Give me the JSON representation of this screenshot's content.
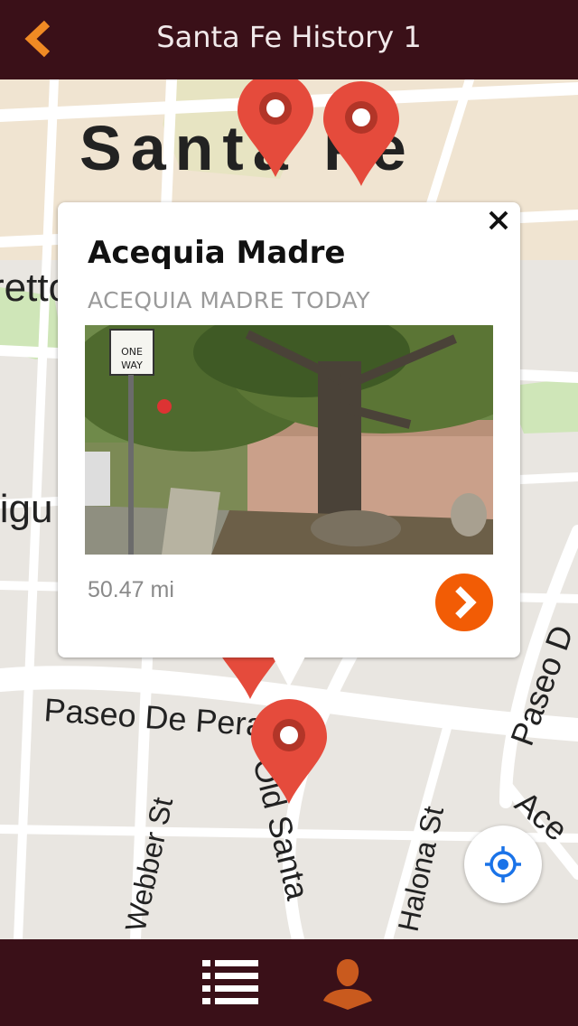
{
  "header": {
    "title": "Santa Fe History 1",
    "back_icon": "chevron-left-icon",
    "accent": "#f08a24"
  },
  "map": {
    "city_label": "Santa Fe",
    "street_labels": [
      "Paseo De Peralta",
      "Webber St",
      "Old Santa",
      "Halona St",
      "Paseo D",
      "Ace",
      "retto",
      "ligu"
    ]
  },
  "callout": {
    "title": "Acequia Madre",
    "subtitle": "ACEQUIA MADRE TODAY",
    "distance": "50.47 mi",
    "close_icon": "close-icon",
    "go_icon": "chevron-right-icon",
    "go_color": "#f25c05"
  },
  "photo": {
    "sign_text": [
      "ONE",
      "WAY"
    ]
  },
  "controls": {
    "locate_icon": "crosshair-icon"
  },
  "footer": {
    "list_icon": "list-icon",
    "person_icon": "person-icon",
    "accent": "#c95a1e",
    "bg": "#3a1018"
  },
  "pin_color": "#e54b3c"
}
